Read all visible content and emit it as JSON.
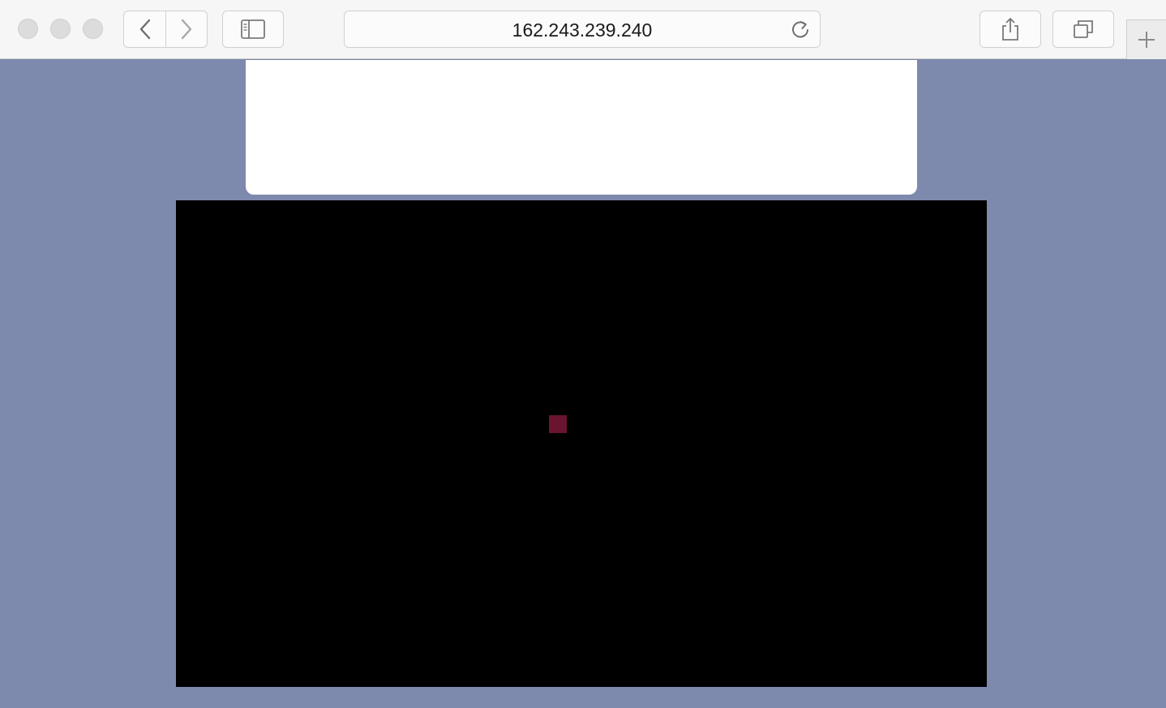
{
  "browser": {
    "address": "162.243.239.240",
    "icons": {
      "back": "chevron-left-icon",
      "forward": "chevron-right-icon",
      "sidebar": "sidebar-icon",
      "reload": "reload-icon",
      "share": "share-icon",
      "tabs": "tabs-overview-icon",
      "new_tab": "plus-icon"
    }
  },
  "page": {
    "background_color": "#7d89ad",
    "panel_color": "#ffffff",
    "canvas_color": "#000000",
    "square_color": "#6b1430"
  }
}
